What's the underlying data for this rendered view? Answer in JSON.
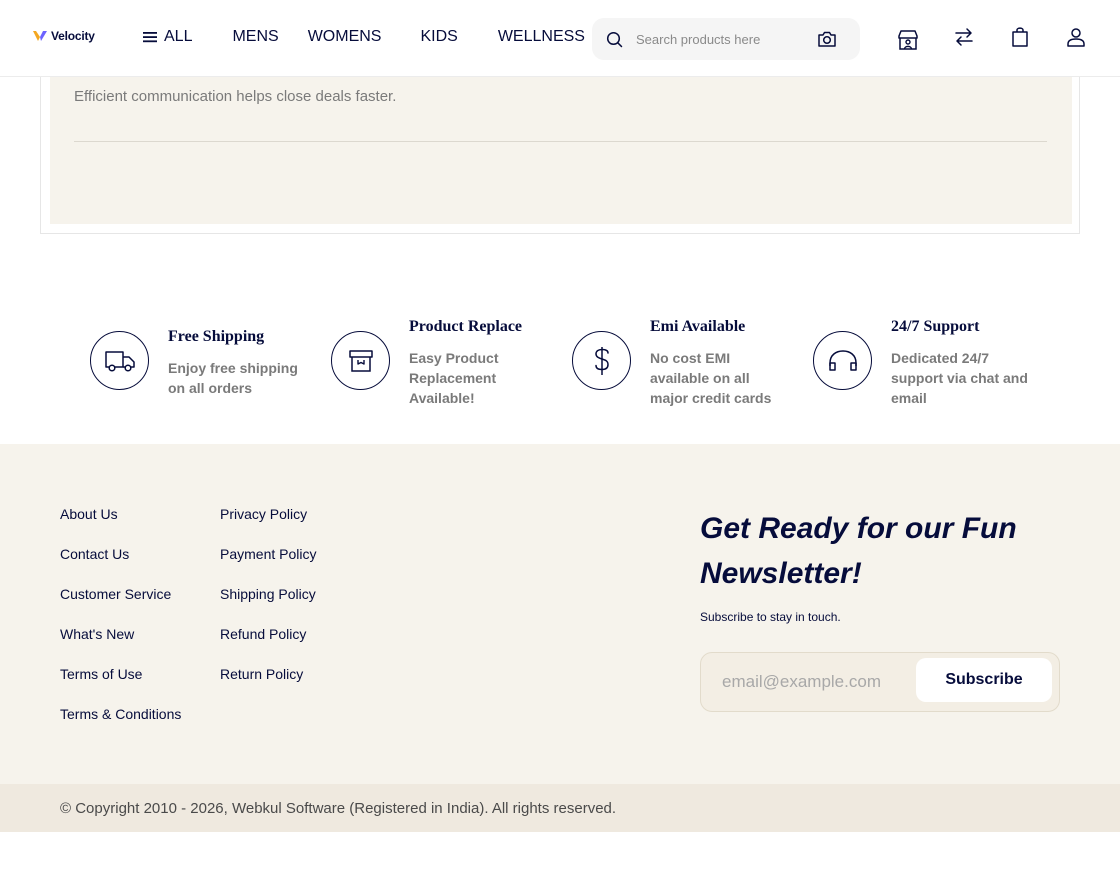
{
  "header": {
    "logo_text": "Velocity",
    "nav": [
      {
        "label": "ALL"
      },
      {
        "label": "MENS"
      },
      {
        "label": "WOMENS"
      },
      {
        "label": "KIDS"
      },
      {
        "label": "WELLNESS"
      }
    ],
    "search_placeholder": "Search products here"
  },
  "card": {
    "text": "Efficient communication helps close deals faster."
  },
  "features": [
    {
      "title": "Free Shipping",
      "desc": "Enjoy free shipping on all orders",
      "icon": "truck-icon"
    },
    {
      "title": "Product Replace",
      "desc": "Easy Product Replacement Available!",
      "icon": "box-icon"
    },
    {
      "title": "Emi Available",
      "desc": "No cost EMI available on all major credit cards",
      "icon": "dollar-icon"
    },
    {
      "title": "24/7 Support",
      "desc": "Dedicated 24/7 support via chat and email",
      "icon": "headphones-icon"
    }
  ],
  "footer": {
    "links_col1": [
      "About Us",
      "Contact Us",
      "Customer Service",
      "What's New",
      "Terms of Use",
      "Terms & Conditions"
    ],
    "links_col2": [
      "Privacy Policy",
      "Payment Policy",
      "Shipping Policy",
      "Refund Policy",
      "Return Policy"
    ],
    "newsletter": {
      "title": "Get Ready for our Fun Newsletter!",
      "subtitle": "Subscribe to stay in touch.",
      "placeholder": "email@example.com",
      "button": "Subscribe"
    },
    "copyright": "© Copyright 2010 - 2026, Webkul Software (Registered in India). All rights reserved."
  },
  "colors": {
    "primary": "#060c3b",
    "footer_bg": "#f6f3ec",
    "copyright_bg": "#efe9df"
  }
}
